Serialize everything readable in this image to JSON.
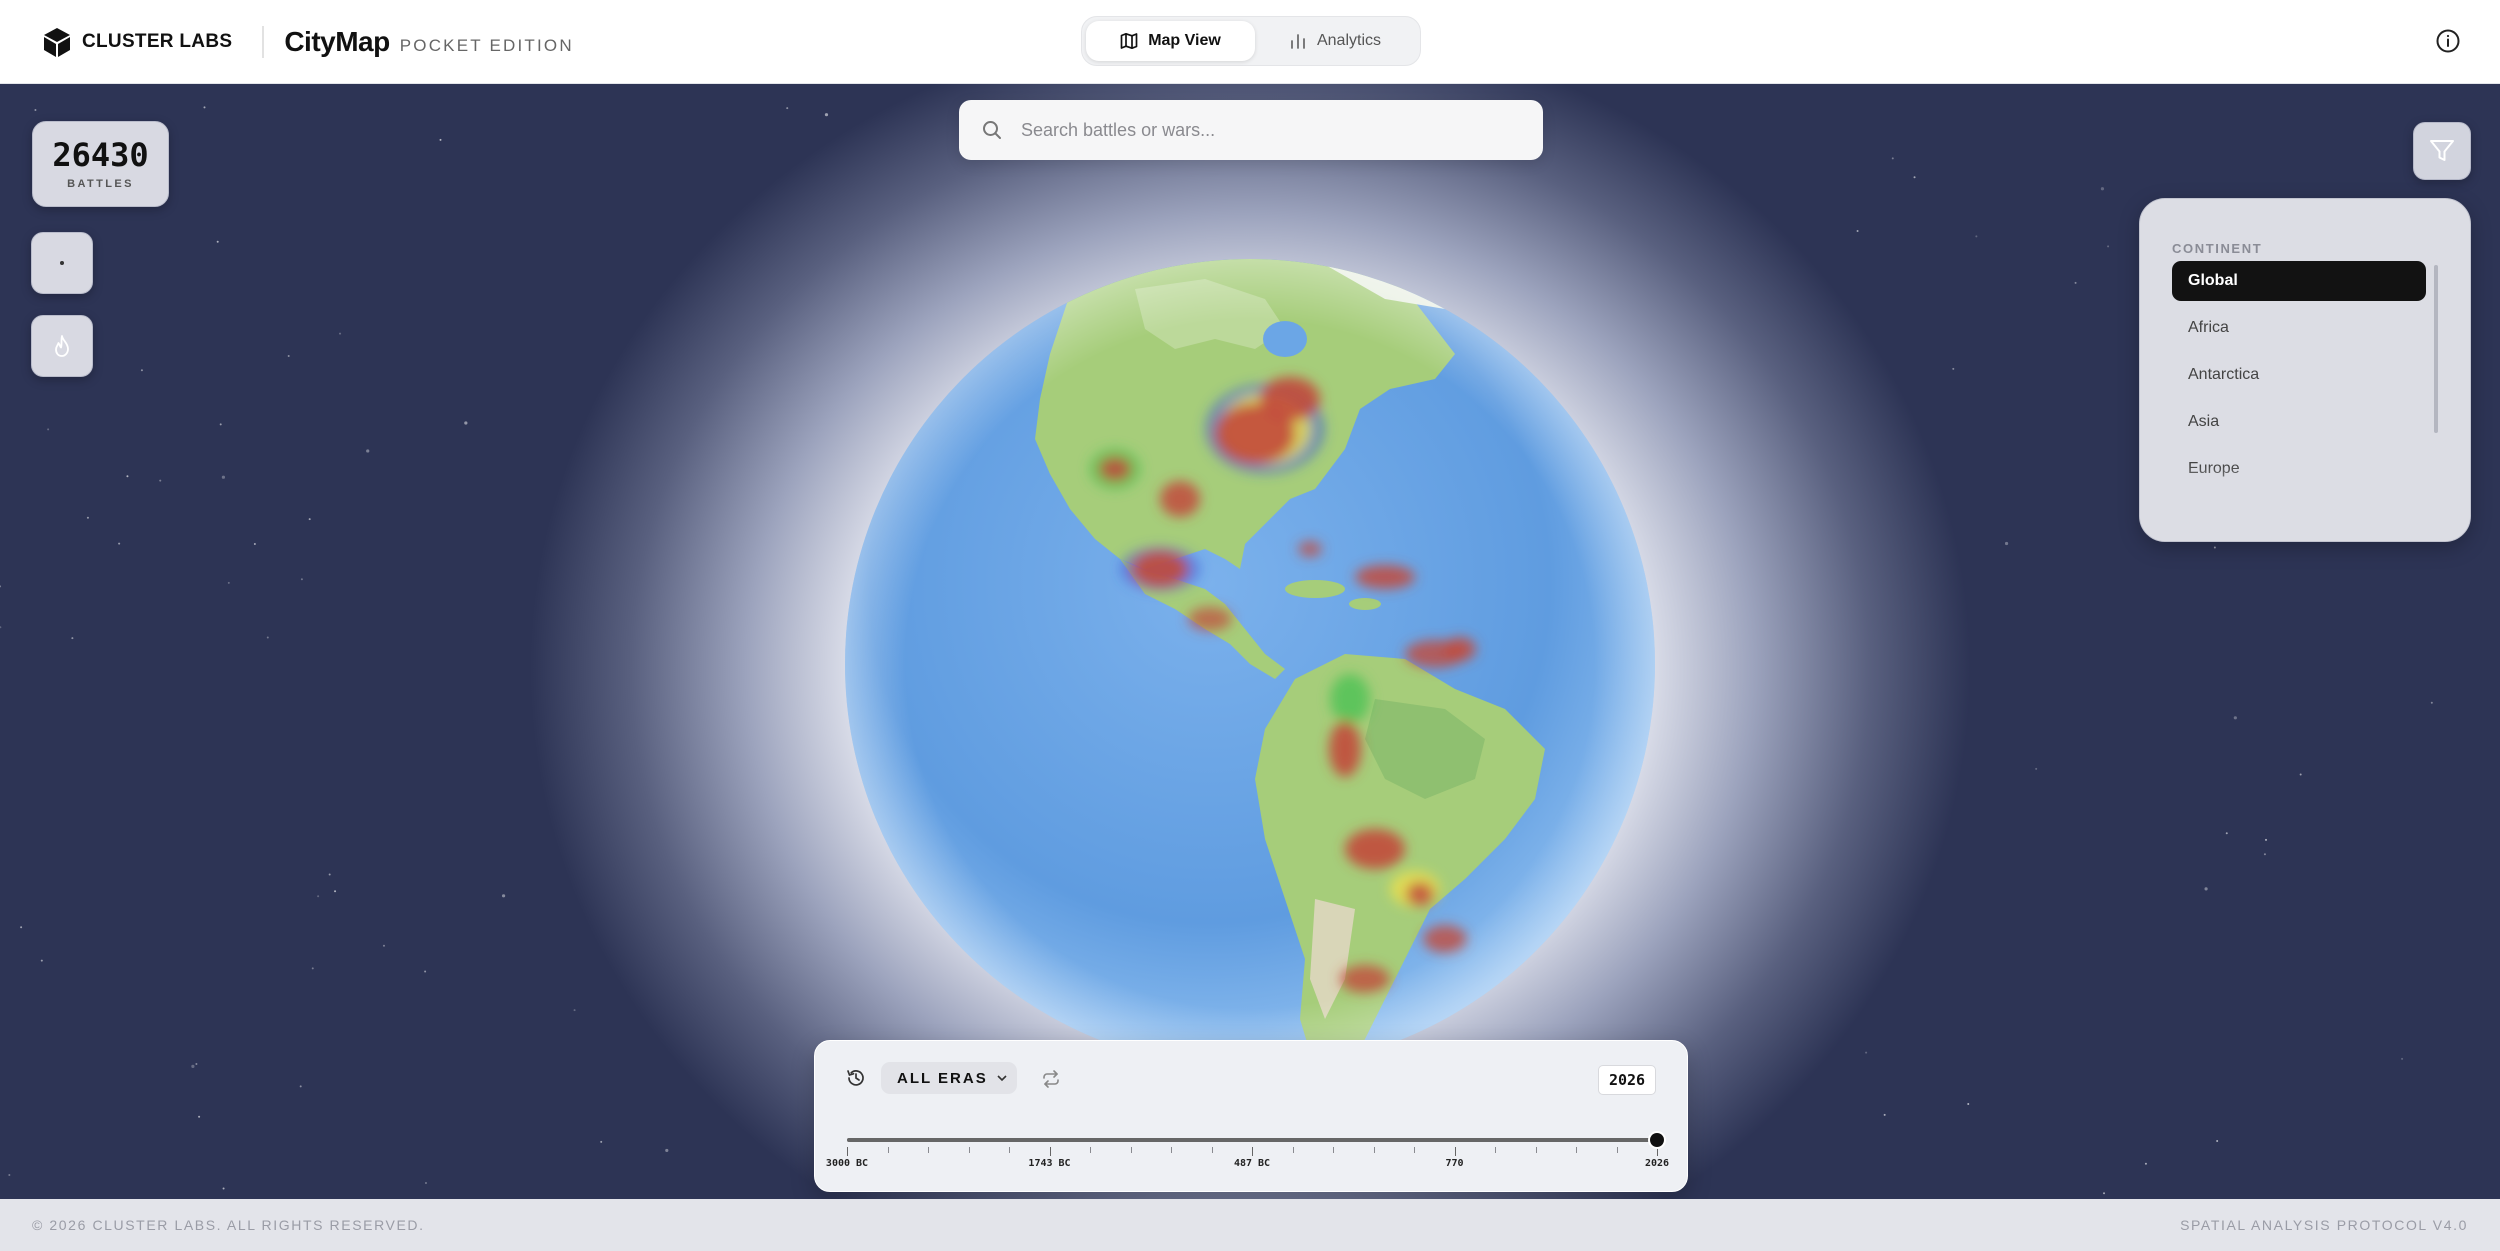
{
  "header": {
    "brand_name": "CLUSTER LABS",
    "app_title": "CityMap",
    "app_subtitle": "POCKET EDITION",
    "tabs": [
      {
        "label": "Map View",
        "icon": "map-icon",
        "active": true
      },
      {
        "label": "Analytics",
        "icon": "bar-chart-icon",
        "active": false
      }
    ],
    "info_icon": "info-icon"
  },
  "search": {
    "placeholder": "Search battles or wars...",
    "value": ""
  },
  "stats": {
    "count": "26430",
    "label": "BATTLES"
  },
  "layer_buttons": [
    {
      "name": "points",
      "icon": "dot-icon"
    },
    {
      "name": "heatmap",
      "icon": "flame-icon"
    }
  ],
  "filter": {
    "icon": "filter-icon",
    "heading": "CONTINENT",
    "items": [
      "Global",
      "Africa",
      "Antarctica",
      "Asia",
      "Europe"
    ],
    "selected": "Global"
  },
  "timeline": {
    "era_label": "ALL ERAS",
    "current_year": "2026",
    "position": 1.0,
    "ticks": [
      "3000 BC",
      "1743 BC",
      "487 BC",
      "770",
      "2026"
    ]
  },
  "footer": {
    "copyright": "© 2026 CLUSTER LABS. ALL RIGHTS RESERVED.",
    "protocol": "SPATIAL ANALYSIS PROTOCOL V4.0"
  },
  "colors": {
    "accent": "#121212",
    "ocean": "#6ea6e6",
    "land": "#a9cd7c",
    "heat_high": "#c24a3c",
    "background": "#2a3150"
  }
}
